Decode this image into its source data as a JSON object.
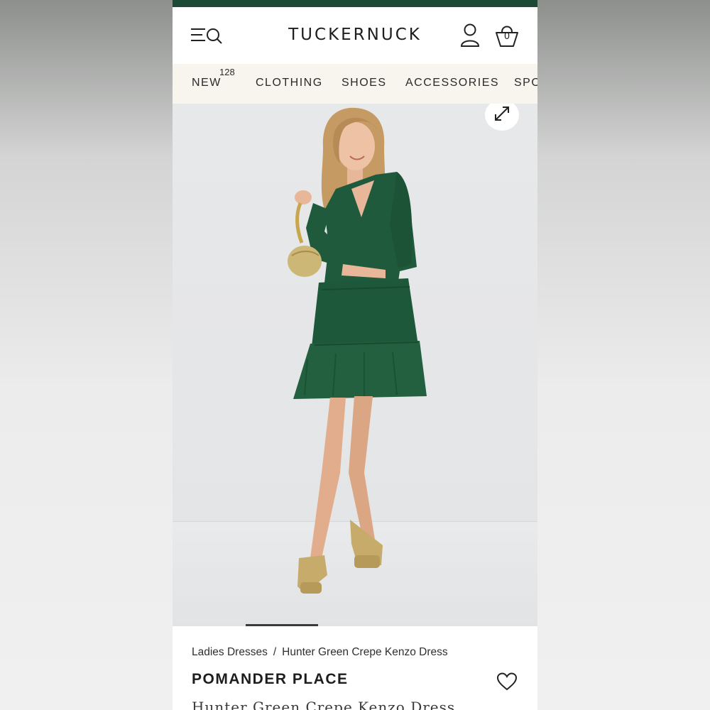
{
  "header": {
    "logo": "TUCKERNUCK",
    "bag_count": "0",
    "icons": {
      "menu_search": "menu-search-icon",
      "account": "user-icon",
      "bag": "shopping-bag-icon"
    }
  },
  "nav": {
    "items": [
      {
        "label": "NEW",
        "badge": "128"
      },
      {
        "label": "CLOTHING"
      },
      {
        "label": "SHOES"
      },
      {
        "label": "ACCESSORIES"
      },
      {
        "label": "SPO"
      }
    ]
  },
  "hero": {
    "expand_icon": "expand-icon",
    "carousel_position": 0.2
  },
  "product": {
    "breadcrumb": [
      "Ladies Dresses",
      "/",
      "Hunter Green Crepe Kenzo Dress"
    ],
    "brand": "POMANDER PLACE",
    "name": "Hunter Green Crepe Kenzo Dress",
    "wishlist_icon": "heart-icon"
  },
  "colors": {
    "accent_strip": "#1c4a34",
    "nav_background": "#f8f5ee",
    "dress_green": "#1f5a3c"
  }
}
